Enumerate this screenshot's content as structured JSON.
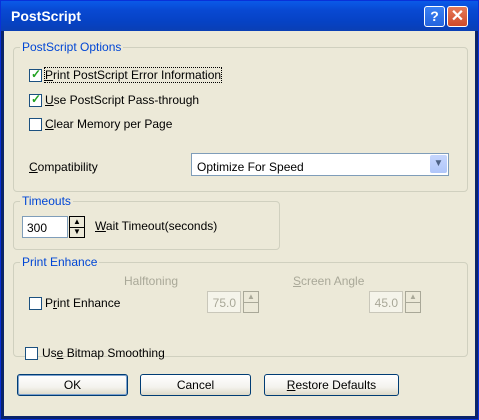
{
  "window": {
    "title": "PostScript"
  },
  "titlebar": {
    "help_icon": "?",
    "close_icon": "✕"
  },
  "options": {
    "group_label": "PostScript Options",
    "print_error": {
      "label_access": "P",
      "label_rest": "rint PostScript Error Information",
      "checked": true
    },
    "pass_through": {
      "label_access": "U",
      "label_rest": "se PostScript Pass-through",
      "checked": true
    },
    "clear_memory": {
      "label_access": "C",
      "label_rest": "lear Memory per Page",
      "checked": false
    },
    "compat_label_access": "C",
    "compat_label_rest": "ompatibility",
    "compat_value": "Optimize For Speed"
  },
  "timeouts": {
    "group_label": "Timeouts",
    "value": "300",
    "label_access": "W",
    "label_rest": "ait Timeout(seconds)"
  },
  "enhance": {
    "group_label": "Print Enhance",
    "halftoning_label": "Halftoning",
    "screen_angle_access": "S",
    "screen_angle_rest": "creen Angle",
    "print_enhance_pre": "P",
    "print_enhance_access": "r",
    "print_enhance_rest": "int Enhance",
    "halftoning_value": "75.0",
    "angle_value": "45.0"
  },
  "bitmap": {
    "pre": "Us",
    "access": "e",
    "rest": " Bitmap Smoothing",
    "checked": false
  },
  "buttons": {
    "ok": "OK",
    "cancel": "Cancel",
    "restore_access": "R",
    "restore_rest": "estore Defaults"
  }
}
